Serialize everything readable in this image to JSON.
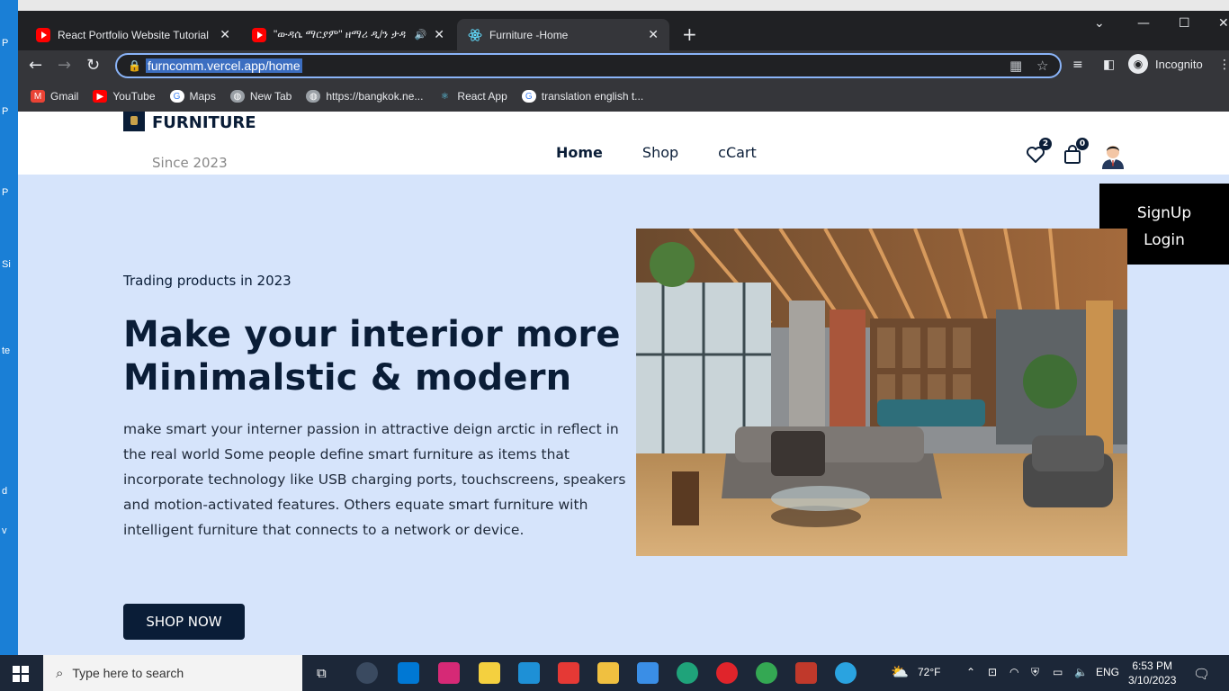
{
  "desktop": {
    "edge_letters": [
      "P",
      "P",
      "P",
      "Si",
      "te",
      "d",
      "v"
    ]
  },
  "browser": {
    "tabs": [
      {
        "title": "React Portfolio Website Tutorial I",
        "icon": "youtube-icon"
      },
      {
        "title": "\"ውዳሴ ማርያም\" ዘማሪ ዲ/ን ታዳ",
        "icon": "youtube-icon"
      },
      {
        "title": "Furniture -Home",
        "icon": "react-icon"
      }
    ],
    "url": "furncomm.vercel.app/home",
    "profile_label": "Incognito",
    "bookmarks": [
      {
        "label": "Gmail",
        "icon": "gmail-icon",
        "color": "#ea4335"
      },
      {
        "label": "YouTube",
        "icon": "youtube-icon",
        "color": "#ff0000"
      },
      {
        "label": "Maps",
        "icon": "google-icon",
        "color": "#4285f4"
      },
      {
        "label": "New Tab",
        "icon": "globe-icon",
        "color": "#5f6368"
      },
      {
        "label": "https://bangkok.ne...",
        "icon": "globe-icon",
        "color": "#5f6368"
      },
      {
        "label": "React App",
        "icon": "react-icon",
        "color": "#61dafb"
      },
      {
        "label": "translation english t...",
        "icon": "google-icon",
        "color": "#4285f4"
      }
    ]
  },
  "site": {
    "brand": "FURNITURE",
    "since": "Since 2023",
    "nav": [
      "Home",
      "Shop",
      "cCart"
    ],
    "wishlist_count": "2",
    "cart_count": "0",
    "dropdown": [
      "SignUp",
      "Login"
    ],
    "eyebrow": "Trading products in 2023",
    "title": "Make your interior more Minimalstic & modern",
    "description": "make smart your interner passion in attractive deign arctic in reflect in the real world Some people define smart furniture as items that incorporate technology like USB charging ports, touchscreens, speakers and motion-activated features. Others equate smart furniture with intelligent furniture that connects to a network or device.",
    "cta": "SHOP NOW",
    "colors": {
      "primary": "#0a1d37",
      "hero_bg": "#d6e4fb"
    }
  },
  "taskbar": {
    "search_placeholder": "Type here to search",
    "weather": "72°F",
    "language": "ENG",
    "time": "6:53 PM",
    "date": "3/10/2023"
  }
}
